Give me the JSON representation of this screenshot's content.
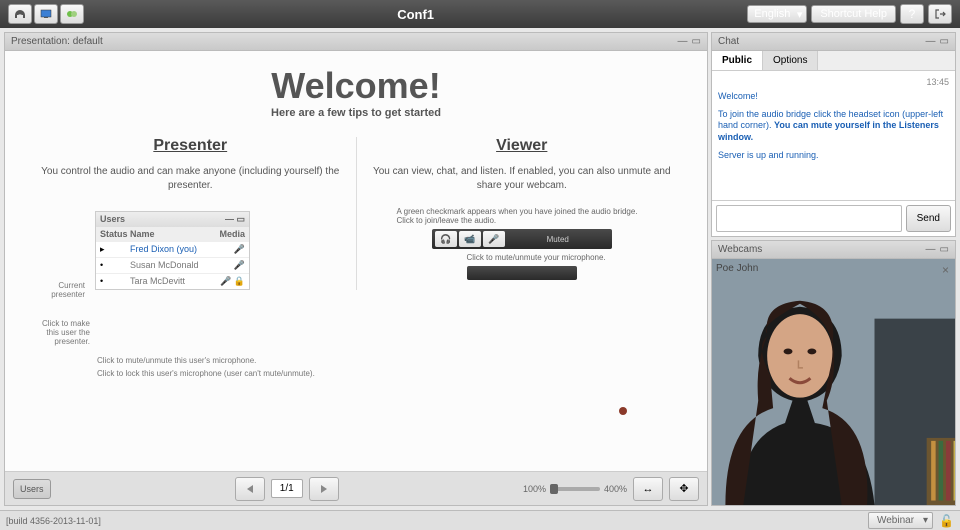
{
  "topbar": {
    "title": "Conf1",
    "language": "English",
    "shortcut_help": "Shortcut Help"
  },
  "presentation": {
    "header": "Presentation: default",
    "welcome_title": "Welcome!",
    "welcome_sub": "Here are a few tips to get started",
    "presenter_h": "Presenter",
    "presenter_p": "You control the audio and can make anyone (including yourself) the presenter.",
    "viewer_h": "Viewer",
    "viewer_p": "You can view, chat, and listen.  If enabled, you can also unmute and share your webcam.",
    "users_table": {
      "title": "Users",
      "cols": {
        "status": "Status",
        "name": "Name",
        "media": "Media"
      },
      "rows": [
        {
          "name": "Fred Dixon (you)"
        },
        {
          "name": "Susan McDonald"
        },
        {
          "name": "Tara McDevitt"
        }
      ]
    },
    "ann_current": "Current presenter",
    "ann_click_make": "Click to make this user the presenter.",
    "ann_mute": "Click to mute/unmute this user's microphone.",
    "ann_lock": "Click to lock this user's microphone (user can't mute/unmute).",
    "viewer_diag_p": "A green checkmark appears when you have joined the audio bridge.  Click to join/leave the audio.",
    "muted_label": "Muted",
    "viewer_diag_mute": "Click to mute/unmute your microphone.",
    "page": "1/1",
    "zoom_min": "100%",
    "zoom_max": "400%",
    "users_btn": "Users"
  },
  "chat": {
    "header": "Chat",
    "tab_public": "Public",
    "tab_options": "Options",
    "time": "13:45",
    "m1": "Welcome!",
    "m2a": "To join the audio bridge click the headset icon (upper-left hand corner). ",
    "m2b": "You can mute yourself in the Listeners window.",
    "m3": "Server is up and running.",
    "send": "Send"
  },
  "webcam": {
    "header": "Webcams",
    "name": "Poe John"
  },
  "statusbar": {
    "build": "[build 4356-2013-11-01]",
    "dropdown": "Webinar"
  }
}
